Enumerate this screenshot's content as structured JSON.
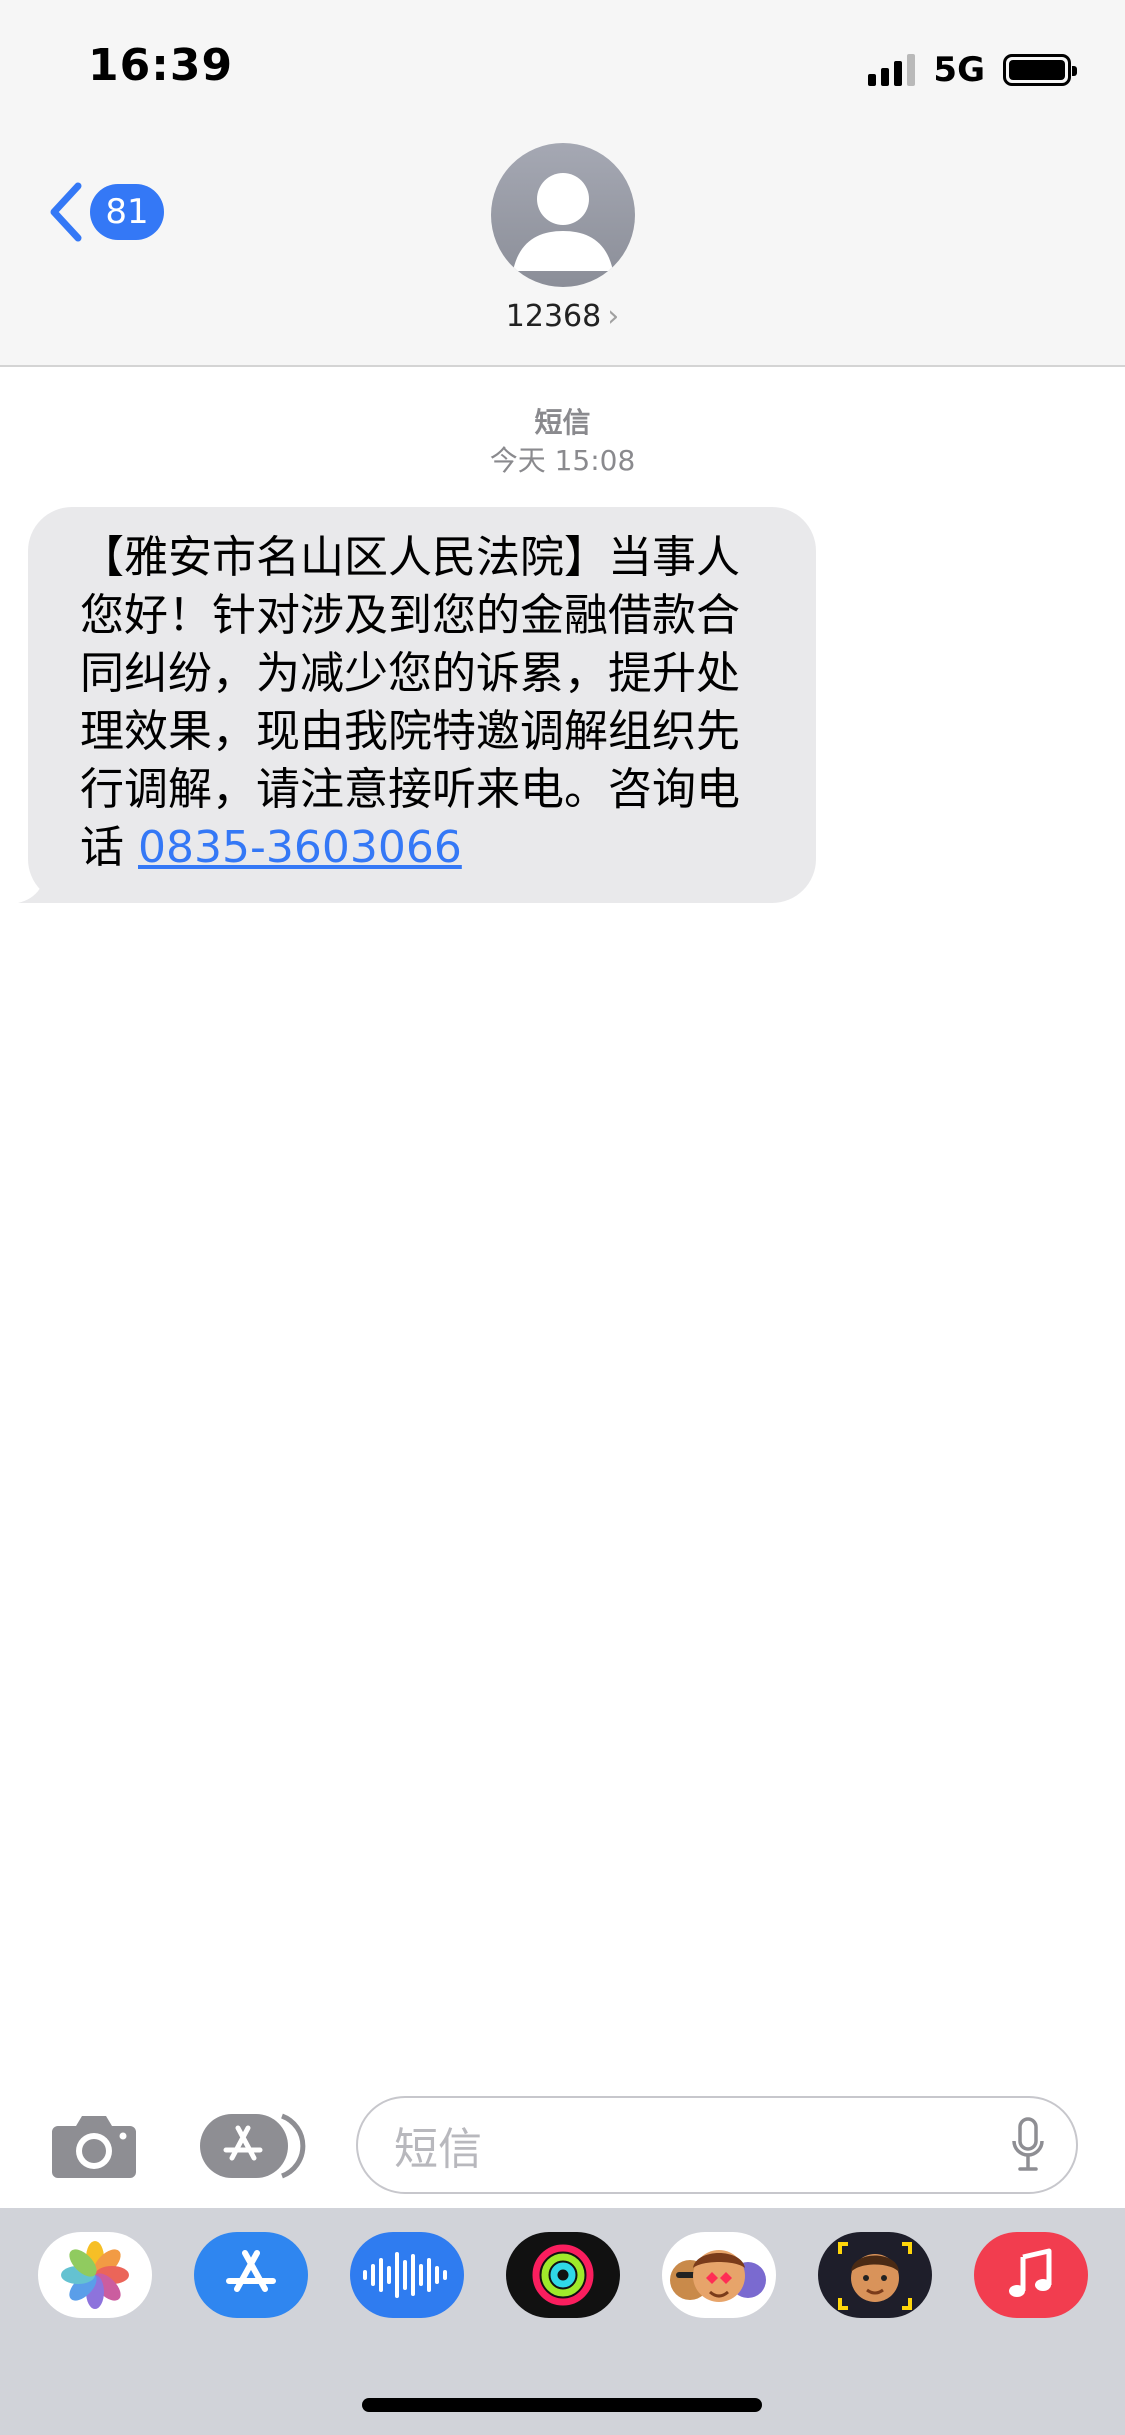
{
  "status_bar": {
    "time": "16:39",
    "network": "5G",
    "signal_bars": 3,
    "signal_max": 4
  },
  "nav": {
    "back_count": "81",
    "contact_name": "12368",
    "contact_chevron": "›",
    "accent_color": "#3478f6"
  },
  "thread": {
    "service_label": "短信",
    "timestamp": "今天 15:08"
  },
  "message": {
    "body": "【雅安市名山区人民法院】当事人您好！针对涉及到您的金融借款合同纠纷，为减少您的诉累，提升处理效果，现由我院特邀调解组织先行调解，请注意接听来电。咨询电话 ",
    "phone_link": "0835-3603066"
  },
  "input_bar": {
    "placeholder": "短信",
    "camera_icon": "camera-icon",
    "apps_icon": "app-store-icon",
    "mic_icon": "microphone-icon"
  },
  "app_drawer": {
    "apps": [
      {
        "name": "photos-app-icon"
      },
      {
        "name": "app-store-app-icon"
      },
      {
        "name": "audio-message-app-icon"
      },
      {
        "name": "fitness-app-icon"
      },
      {
        "name": "memoji-stickers-app-icon"
      },
      {
        "name": "animoji-app-icon"
      },
      {
        "name": "music-app-icon"
      }
    ]
  }
}
